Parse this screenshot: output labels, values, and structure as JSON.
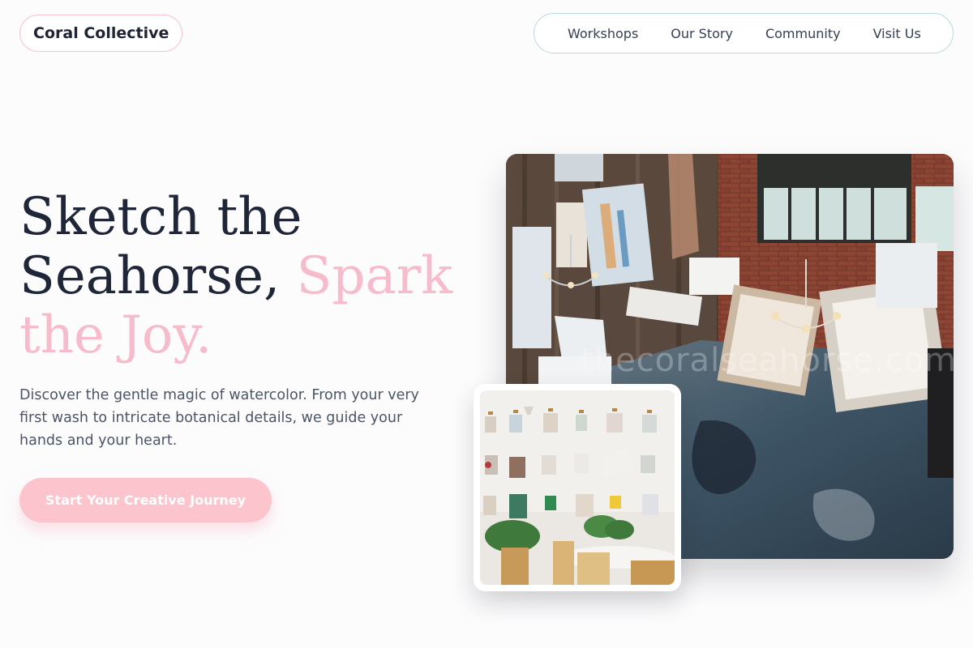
{
  "brand": {
    "name": "Coral Collective"
  },
  "nav": {
    "items": [
      {
        "label": "Workshops"
      },
      {
        "label": "Our Story"
      },
      {
        "label": "Community"
      },
      {
        "label": "Visit Us"
      }
    ]
  },
  "hero": {
    "headline_part1": "Sketch the Seahorse, ",
    "headline_part2": "Spark the Joy.",
    "lede": "Discover the gentle magic of watercolor. From your very first wash to intricate botanical details, we guide your hands and your heart.",
    "cta_label": "Start Your Creative Journey"
  },
  "images": {
    "main_watermark": "thecoralseahorse.com"
  },
  "colors": {
    "accent_pink": "#f7bccb",
    "cta_pink": "#fcc4cc",
    "nav_border": "#b9d8de",
    "brand_border": "#f7c3cf",
    "text_dark": "#1f2638"
  }
}
